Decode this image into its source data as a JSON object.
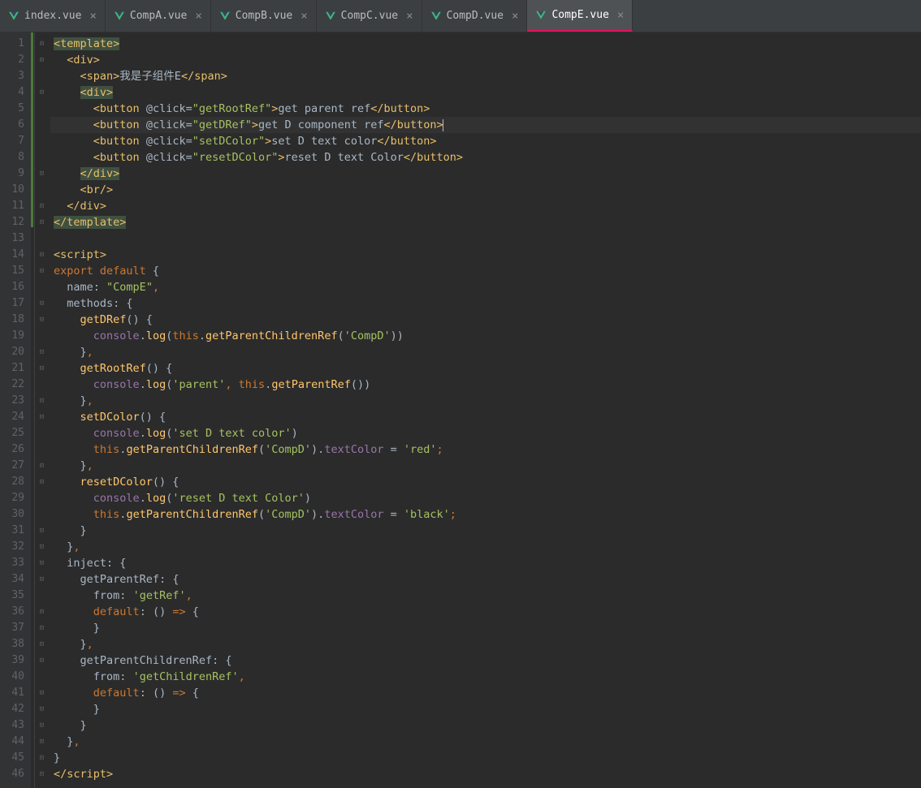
{
  "tabs": [
    {
      "label": "index.vue",
      "active": false
    },
    {
      "label": "CompA.vue",
      "active": false
    },
    {
      "label": "CompB.vue",
      "active": false
    },
    {
      "label": "CompC.vue",
      "active": false
    },
    {
      "label": "CompD.vue",
      "active": false
    },
    {
      "label": "CompE.vue",
      "active": true
    }
  ],
  "activeLine": 6,
  "lines": [
    {
      "n": 1,
      "fold": "−",
      "tokens": [
        [
          "tag",
          "<template>"
        ]
      ],
      "templateHl": true
    },
    {
      "n": 2,
      "fold": "−",
      "indent": 1,
      "tokens": [
        [
          "tag",
          "<div>"
        ]
      ]
    },
    {
      "n": 3,
      "indent": 2,
      "tokens": [
        [
          "tag",
          "<span>"
        ],
        [
          "text",
          "我是子组件E"
        ],
        [
          "tag",
          "</span>"
        ]
      ]
    },
    {
      "n": 4,
      "fold": "−",
      "indent": 2,
      "tokens": [
        [
          "tag",
          "<div>"
        ]
      ],
      "divHl": true
    },
    {
      "n": 5,
      "indent": 3,
      "tokens": [
        [
          "tag",
          "<button "
        ],
        [
          "attr",
          "@click"
        ],
        [
          "punct",
          "="
        ],
        [
          "string",
          "\"getRootRef\""
        ],
        [
          "tag",
          ">"
        ],
        [
          "text",
          "get parent ref"
        ],
        [
          "tag",
          "</button>"
        ]
      ]
    },
    {
      "n": 6,
      "indent": 3,
      "hl": true,
      "tokens": [
        [
          "tag",
          "<button "
        ],
        [
          "attr",
          "@click"
        ],
        [
          "punct",
          "="
        ],
        [
          "string",
          "\"getDRef\""
        ],
        [
          "tag",
          ">"
        ],
        [
          "text",
          "get D component ref"
        ],
        [
          "tag",
          "</button>"
        ]
      ],
      "caret": true
    },
    {
      "n": 7,
      "indent": 3,
      "tokens": [
        [
          "tag",
          "<button "
        ],
        [
          "attr",
          "@click"
        ],
        [
          "punct",
          "="
        ],
        [
          "string",
          "\"setDColor\""
        ],
        [
          "tag",
          ">"
        ],
        [
          "text",
          "set D text color"
        ],
        [
          "tag",
          "</button>"
        ]
      ]
    },
    {
      "n": 8,
      "indent": 3,
      "tokens": [
        [
          "tag",
          "<button "
        ],
        [
          "attr",
          "@click"
        ],
        [
          "punct",
          "="
        ],
        [
          "string",
          "\"resetDColor\""
        ],
        [
          "tag",
          ">"
        ],
        [
          "text",
          "reset D text Color"
        ],
        [
          "tag",
          "</button>"
        ]
      ]
    },
    {
      "n": 9,
      "fold": "⌃",
      "indent": 2,
      "tokens": [
        [
          "tag",
          "</div>"
        ]
      ],
      "divHl": true
    },
    {
      "n": 10,
      "indent": 2,
      "tokens": [
        [
          "tag",
          "<br/>"
        ]
      ]
    },
    {
      "n": 11,
      "fold": "⌃",
      "indent": 1,
      "tokens": [
        [
          "tag",
          "</div>"
        ]
      ]
    },
    {
      "n": 12,
      "fold": "⌃",
      "tokens": [
        [
          "tag",
          "</template>"
        ]
      ],
      "templateHl": true
    },
    {
      "n": 13,
      "tokens": []
    },
    {
      "n": 14,
      "fold": "−",
      "tokens": [
        [
          "tag",
          "<script>"
        ]
      ]
    },
    {
      "n": 15,
      "fold": "−",
      "tokens": [
        [
          "keyword",
          "export default "
        ],
        [
          "punct",
          "{"
        ]
      ]
    },
    {
      "n": 16,
      "indent": 1,
      "tokens": [
        [
          "ident",
          "name"
        ],
        [
          "punct",
          ": "
        ],
        [
          "string",
          "\"CompE\""
        ],
        [
          "keyword",
          ","
        ]
      ]
    },
    {
      "n": 17,
      "fold": "−",
      "indent": 1,
      "tokens": [
        [
          "ident",
          "methods"
        ],
        [
          "punct",
          ": {"
        ]
      ]
    },
    {
      "n": 18,
      "fold": "−",
      "indent": 2,
      "tokens": [
        [
          "name",
          "getDRef"
        ],
        [
          "punct",
          "() {"
        ]
      ],
      "lineMark": true
    },
    {
      "n": 19,
      "indent": 3,
      "tokens": [
        [
          "prop",
          "console"
        ],
        [
          "punct",
          "."
        ],
        [
          "name",
          "log"
        ],
        [
          "punct",
          "("
        ],
        [
          "keyword",
          "this"
        ],
        [
          "punct",
          "."
        ],
        [
          "name",
          "getParentChildrenRef"
        ],
        [
          "punct",
          "("
        ],
        [
          "string",
          "'CompD'"
        ],
        [
          "punct",
          "))"
        ]
      ]
    },
    {
      "n": 20,
      "fold": "⌃",
      "indent": 2,
      "tokens": [
        [
          "punct",
          "}"
        ],
        [
          "keyword",
          ","
        ]
      ]
    },
    {
      "n": 21,
      "fold": "−",
      "indent": 2,
      "tokens": [
        [
          "name",
          "getRootRef"
        ],
        [
          "punct",
          "() {"
        ]
      ]
    },
    {
      "n": 22,
      "indent": 3,
      "tokens": [
        [
          "prop",
          "console"
        ],
        [
          "punct",
          "."
        ],
        [
          "name",
          "log"
        ],
        [
          "punct",
          "("
        ],
        [
          "string",
          "'parent'"
        ],
        [
          "keyword",
          ", "
        ],
        [
          "keyword",
          "this"
        ],
        [
          "punct",
          "."
        ],
        [
          "name",
          "getParentRef"
        ],
        [
          "punct",
          "())"
        ]
      ]
    },
    {
      "n": 23,
      "fold": "⌃",
      "indent": 2,
      "tokens": [
        [
          "punct",
          "}"
        ],
        [
          "keyword",
          ","
        ]
      ]
    },
    {
      "n": 24,
      "fold": "−",
      "indent": 2,
      "tokens": [
        [
          "name",
          "setDColor"
        ],
        [
          "punct",
          "() {"
        ]
      ]
    },
    {
      "n": 25,
      "indent": 3,
      "tokens": [
        [
          "prop",
          "console"
        ],
        [
          "punct",
          "."
        ],
        [
          "name",
          "log"
        ],
        [
          "punct",
          "("
        ],
        [
          "string",
          "'set D text color'"
        ],
        [
          "punct",
          ")"
        ]
      ]
    },
    {
      "n": 26,
      "indent": 3,
      "tokens": [
        [
          "keyword",
          "this"
        ],
        [
          "punct",
          "."
        ],
        [
          "name",
          "getParentChildrenRef"
        ],
        [
          "punct",
          "("
        ],
        [
          "string",
          "'CompD'"
        ],
        [
          "punct",
          ")."
        ],
        [
          "prop",
          "textColor"
        ],
        [
          "punct",
          " = "
        ],
        [
          "string",
          "'red'"
        ],
        [
          "keyword",
          ";"
        ]
      ]
    },
    {
      "n": 27,
      "fold": "⌃",
      "indent": 2,
      "tokens": [
        [
          "punct",
          "}"
        ],
        [
          "keyword",
          ","
        ]
      ]
    },
    {
      "n": 28,
      "fold": "−",
      "indent": 2,
      "tokens": [
        [
          "name",
          "resetDColor"
        ],
        [
          "punct",
          "() {"
        ]
      ]
    },
    {
      "n": 29,
      "indent": 3,
      "tokens": [
        [
          "prop",
          "console"
        ],
        [
          "punct",
          "."
        ],
        [
          "name",
          "log"
        ],
        [
          "punct",
          "("
        ],
        [
          "string",
          "'reset D text Color'"
        ],
        [
          "punct",
          ")"
        ]
      ]
    },
    {
      "n": 30,
      "indent": 3,
      "tokens": [
        [
          "keyword",
          "this"
        ],
        [
          "punct",
          "."
        ],
        [
          "name",
          "getParentChildrenRef"
        ],
        [
          "punct",
          "("
        ],
        [
          "string",
          "'CompD'"
        ],
        [
          "punct",
          ")."
        ],
        [
          "prop",
          "textColor"
        ],
        [
          "punct",
          " = "
        ],
        [
          "string",
          "'black'"
        ],
        [
          "keyword",
          ";"
        ]
      ]
    },
    {
      "n": 31,
      "fold": "⌃",
      "indent": 2,
      "tokens": [
        [
          "punct",
          "}"
        ]
      ]
    },
    {
      "n": 32,
      "fold": "⌃",
      "indent": 1,
      "tokens": [
        [
          "punct",
          "}"
        ],
        [
          "keyword",
          ","
        ]
      ]
    },
    {
      "n": 33,
      "fold": "−",
      "indent": 1,
      "tokens": [
        [
          "ident",
          "inject"
        ],
        [
          "punct",
          ": {"
        ]
      ]
    },
    {
      "n": 34,
      "fold": "−",
      "indent": 2,
      "tokens": [
        [
          "ident",
          "getParentRef"
        ],
        [
          "punct",
          ": {"
        ]
      ]
    },
    {
      "n": 35,
      "indent": 3,
      "tokens": [
        [
          "ident",
          "from"
        ],
        [
          "punct",
          ": "
        ],
        [
          "string",
          "'getRef'"
        ],
        [
          "keyword",
          ","
        ]
      ]
    },
    {
      "n": 36,
      "fold": "−",
      "indent": 3,
      "tokens": [
        [
          "keyword",
          "default"
        ],
        [
          "punct",
          ": () "
        ],
        [
          "keyword",
          "=>"
        ],
        [
          "punct",
          " {"
        ]
      ]
    },
    {
      "n": 37,
      "fold": "⌃",
      "indent": 3,
      "tokens": [
        [
          "punct",
          "}"
        ]
      ]
    },
    {
      "n": 38,
      "fold": "⌃",
      "indent": 2,
      "tokens": [
        [
          "punct",
          "}"
        ],
        [
          "keyword",
          ","
        ]
      ]
    },
    {
      "n": 39,
      "fold": "−",
      "indent": 2,
      "tokens": [
        [
          "ident",
          "getParentChildrenRef"
        ],
        [
          "punct",
          ": {"
        ]
      ]
    },
    {
      "n": 40,
      "indent": 3,
      "tokens": [
        [
          "ident",
          "from"
        ],
        [
          "punct",
          ": "
        ],
        [
          "string",
          "'getChildrenRef'"
        ],
        [
          "keyword",
          ","
        ]
      ]
    },
    {
      "n": 41,
      "fold": "−",
      "indent": 3,
      "tokens": [
        [
          "keyword",
          "default"
        ],
        [
          "punct",
          ": () "
        ],
        [
          "keyword",
          "=>"
        ],
        [
          "punct",
          " {"
        ]
      ]
    },
    {
      "n": 42,
      "fold": "⌃",
      "indent": 3,
      "tokens": [
        [
          "punct",
          "}"
        ]
      ]
    },
    {
      "n": 43,
      "fold": "⌃",
      "indent": 2,
      "tokens": [
        [
          "punct",
          "}"
        ]
      ]
    },
    {
      "n": 44,
      "fold": "⌃",
      "indent": 1,
      "tokens": [
        [
          "punct",
          "}"
        ],
        [
          "keyword",
          ","
        ]
      ]
    },
    {
      "n": 45,
      "fold": "⌃",
      "tokens": [
        [
          "punct",
          "}"
        ]
      ]
    },
    {
      "n": 46,
      "fold": "⌃",
      "tokens": [
        [
          "tag",
          "</"
        ],
        [
          "tag",
          "script>"
        ]
      ]
    }
  ]
}
